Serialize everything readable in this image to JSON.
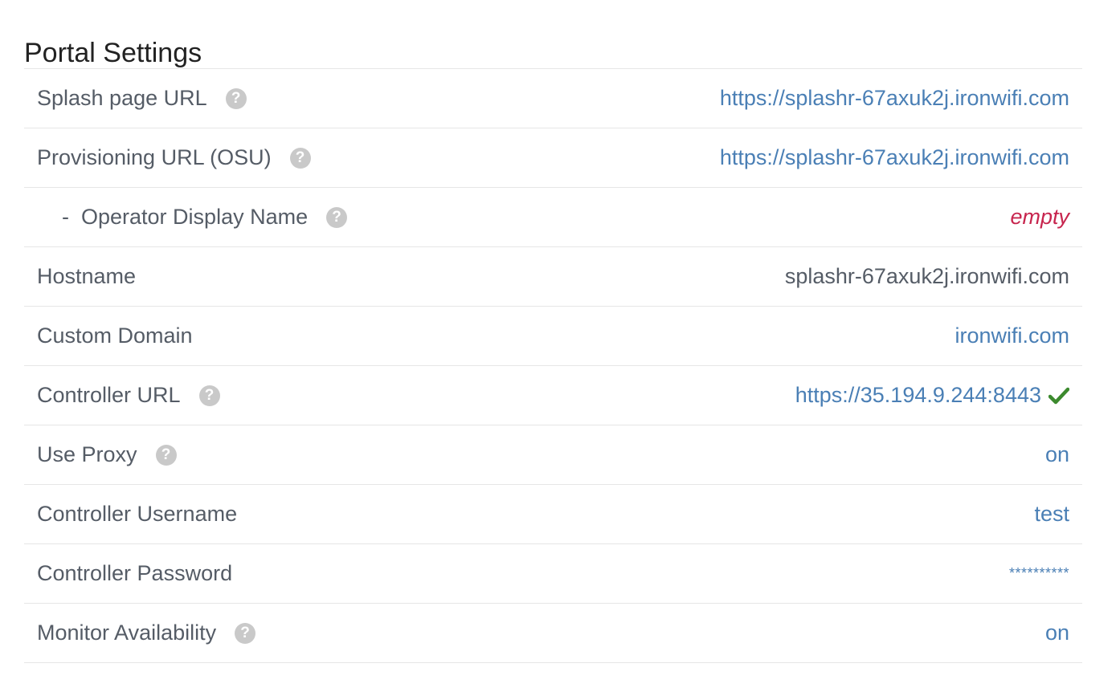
{
  "page": {
    "title": "Portal Settings"
  },
  "colors": {
    "link": "#4a7fb5",
    "empty": "#c7254e",
    "success": "#3c8a2e",
    "help_icon": "#c9c9c9"
  },
  "rows": [
    {
      "label": "Splash page URL",
      "value": "https://splashr-67axuk2j.ironwifi.com",
      "help": true
    },
    {
      "label": "Provisioning URL (OSU)",
      "value": "https://splashr-67axuk2j.ironwifi.com",
      "help": true
    },
    {
      "dash": "-",
      "label": "Operator Display Name",
      "value": "empty",
      "help": true
    },
    {
      "label": "Hostname",
      "value": "splashr-67axuk2j.ironwifi.com",
      "help": false
    },
    {
      "label": "Custom Domain",
      "value": "ironwifi.com",
      "help": false
    },
    {
      "label": "Controller URL",
      "value": "https://35.194.9.244:8443",
      "help": true,
      "status_icon": "check-icon"
    },
    {
      "label": "Use Proxy",
      "value": "on",
      "help": true
    },
    {
      "label": "Controller Username",
      "value": "test",
      "help": false
    },
    {
      "label": "Controller Password",
      "value": "**********",
      "help": false
    },
    {
      "label": "Monitor Availability",
      "value": "on",
      "help": true
    }
  ],
  "icons": {
    "help": "question-circle-icon",
    "help_glyph": "?",
    "status": "check-icon"
  }
}
